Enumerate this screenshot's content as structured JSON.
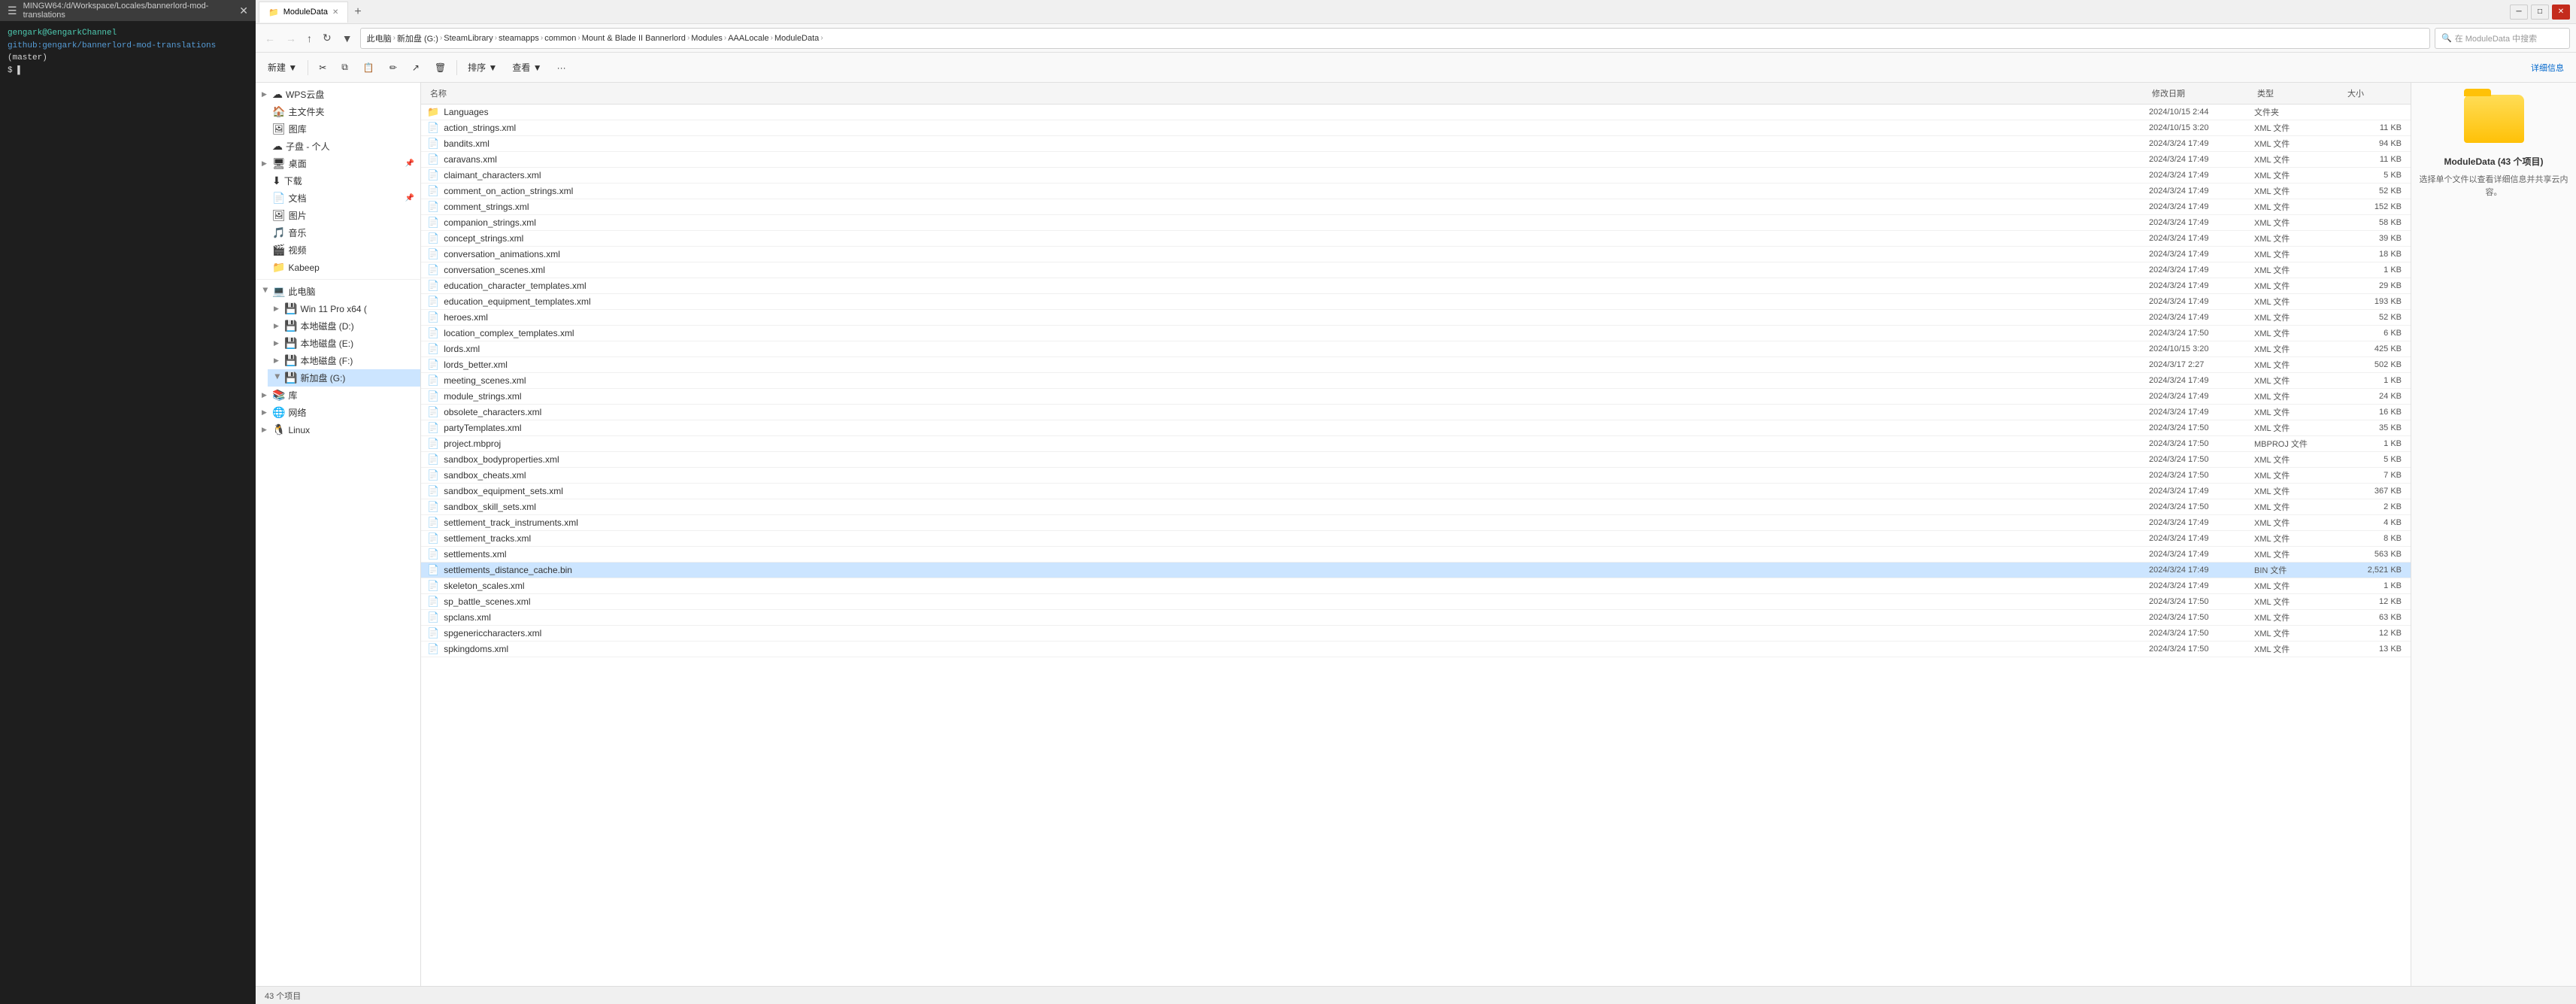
{
  "terminal": {
    "title": "MINGW64:/d/Workspace/Locales/bannerlord-mod-translations",
    "close_btn": "✕",
    "hamburger": "☰",
    "user": "gengark@GengarkChannel",
    "path": "github:gengark/bannerlord-mod-translations",
    "branch": "(master)",
    "prompt": "$",
    "cursor": "▌"
  },
  "explorer": {
    "tab_label": "ModuleData",
    "tab_close": "✕",
    "tab_new": "+",
    "search_placeholder": "在 ModuleData 中搜索",
    "search_icon": "🔍",
    "detail_btn": "详细信息",
    "nav_back": "←",
    "nav_forward": "→",
    "nav_up": "↑",
    "nav_refresh": "↻",
    "nav_path_dropdown": "▼",
    "breadcrumb": [
      "此电脑",
      "新加盘 (G:)",
      "SteamLibrary",
      "steamapps",
      "common",
      "Mount & Blade II Bannerlord",
      "Modules",
      "AAALocale",
      "ModuleData"
    ],
    "toolbar": {
      "new_btn": "新建 ▼",
      "cut_icon": "✂",
      "copy_icon": "⧉",
      "paste_icon": "📋",
      "rename_icon": "✏",
      "share_icon": "↗",
      "delete_icon": "🗑",
      "sort_btn": "排序 ▼",
      "view_btn": "查看 ▼",
      "more_btn": "···"
    },
    "columns": {
      "name": "名称",
      "modified": "修改日期",
      "type": "类型",
      "size": "大小"
    },
    "files": [
      {
        "name": "Languages",
        "modified": "2024/10/15 2:44",
        "type": "文件夹",
        "size": "",
        "icon": "📁",
        "is_folder": true
      },
      {
        "name": "action_strings.xml",
        "modified": "2024/10/15 3:20",
        "type": "XML 文件",
        "size": "11 KB",
        "icon": "📄"
      },
      {
        "name": "bandits.xml",
        "modified": "2024/3/24 17:49",
        "type": "XML 文件",
        "size": "94 KB",
        "icon": "📄"
      },
      {
        "name": "caravans.xml",
        "modified": "2024/3/24 17:49",
        "type": "XML 文件",
        "size": "11 KB",
        "icon": "📄"
      },
      {
        "name": "claimant_characters.xml",
        "modified": "2024/3/24 17:49",
        "type": "XML 文件",
        "size": "5 KB",
        "icon": "📄"
      },
      {
        "name": "comment_on_action_strings.xml",
        "modified": "2024/3/24 17:49",
        "type": "XML 文件",
        "size": "52 KB",
        "icon": "📄"
      },
      {
        "name": "comment_strings.xml",
        "modified": "2024/3/24 17:49",
        "type": "XML 文件",
        "size": "152 KB",
        "icon": "📄"
      },
      {
        "name": "companion_strings.xml",
        "modified": "2024/3/24 17:49",
        "type": "XML 文件",
        "size": "58 KB",
        "icon": "📄"
      },
      {
        "name": "concept_strings.xml",
        "modified": "2024/3/24 17:49",
        "type": "XML 文件",
        "size": "39 KB",
        "icon": "📄"
      },
      {
        "name": "conversation_animations.xml",
        "modified": "2024/3/24 17:49",
        "type": "XML 文件",
        "size": "18 KB",
        "icon": "📄"
      },
      {
        "name": "conversation_scenes.xml",
        "modified": "2024/3/24 17:49",
        "type": "XML 文件",
        "size": "1 KB",
        "icon": "📄"
      },
      {
        "name": "education_character_templates.xml",
        "modified": "2024/3/24 17:49",
        "type": "XML 文件",
        "size": "29 KB",
        "icon": "📄"
      },
      {
        "name": "education_equipment_templates.xml",
        "modified": "2024/3/24 17:49",
        "type": "XML 文件",
        "size": "193 KB",
        "icon": "📄"
      },
      {
        "name": "heroes.xml",
        "modified": "2024/3/24 17:49",
        "type": "XML 文件",
        "size": "52 KB",
        "icon": "📄"
      },
      {
        "name": "location_complex_templates.xml",
        "modified": "2024/3/24 17:50",
        "type": "XML 文件",
        "size": "6 KB",
        "icon": "📄"
      },
      {
        "name": "lords.xml",
        "modified": "2024/10/15 3:20",
        "type": "XML 文件",
        "size": "425 KB",
        "icon": "📄"
      },
      {
        "name": "lords_better.xml",
        "modified": "2024/3/17 2:27",
        "type": "XML 文件",
        "size": "502 KB",
        "icon": "📄"
      },
      {
        "name": "meeting_scenes.xml",
        "modified": "2024/3/24 17:49",
        "type": "XML 文件",
        "size": "1 KB",
        "icon": "📄"
      },
      {
        "name": "module_strings.xml",
        "modified": "2024/3/24 17:49",
        "type": "XML 文件",
        "size": "24 KB",
        "icon": "📄"
      },
      {
        "name": "obsolete_characters.xml",
        "modified": "2024/3/24 17:49",
        "type": "XML 文件",
        "size": "16 KB",
        "icon": "📄"
      },
      {
        "name": "partyTemplates.xml",
        "modified": "2024/3/24 17:50",
        "type": "XML 文件",
        "size": "35 KB",
        "icon": "📄"
      },
      {
        "name": "project.mbproj",
        "modified": "2024/3/24 17:50",
        "type": "MBPROJ 文件",
        "size": "1 KB",
        "icon": "📄"
      },
      {
        "name": "sandbox_bodyproperties.xml",
        "modified": "2024/3/24 17:50",
        "type": "XML 文件",
        "size": "5 KB",
        "icon": "📄"
      },
      {
        "name": "sandbox_cheats.xml",
        "modified": "2024/3/24 17:50",
        "type": "XML 文件",
        "size": "7 KB",
        "icon": "📄"
      },
      {
        "name": "sandbox_equipment_sets.xml",
        "modified": "2024/3/24 17:49",
        "type": "XML 文件",
        "size": "367 KB",
        "icon": "📄"
      },
      {
        "name": "sandbox_skill_sets.xml",
        "modified": "2024/3/24 17:50",
        "type": "XML 文件",
        "size": "2 KB",
        "icon": "📄"
      },
      {
        "name": "settlement_track_instruments.xml",
        "modified": "2024/3/24 17:49",
        "type": "XML 文件",
        "size": "4 KB",
        "icon": "📄"
      },
      {
        "name": "settlement_tracks.xml",
        "modified": "2024/3/24 17:49",
        "type": "XML 文件",
        "size": "8 KB",
        "icon": "📄"
      },
      {
        "name": "settlements.xml",
        "modified": "2024/3/24 17:49",
        "type": "XML 文件",
        "size": "563 KB",
        "icon": "📄"
      },
      {
        "name": "settlements_distance_cache.bin",
        "modified": "2024/3/24 17:49",
        "type": "BIN 文件",
        "size": "2,521 KB",
        "icon": "📄"
      },
      {
        "name": "skeleton_scales.xml",
        "modified": "2024/3/24 17:49",
        "type": "XML 文件",
        "size": "1 KB",
        "icon": "📄"
      },
      {
        "name": "sp_battle_scenes.xml",
        "modified": "2024/3/24 17:50",
        "type": "XML 文件",
        "size": "12 KB",
        "icon": "📄"
      },
      {
        "name": "spclans.xml",
        "modified": "2024/3/24 17:50",
        "type": "XML 文件",
        "size": "63 KB",
        "icon": "📄"
      },
      {
        "name": "spgenericcharacters.xml",
        "modified": "2024/3/24 17:50",
        "type": "XML 文件",
        "size": "12 KB",
        "icon": "📄"
      },
      {
        "name": "spkingdoms.xml",
        "modified": "2024/3/24 17:50",
        "type": "XML 文件",
        "size": "13 KB",
        "icon": "📄"
      }
    ],
    "status_bar": "43 个项目",
    "preview": {
      "title": "ModuleData (43 个项目)",
      "hint": "选择单个文件以查看详细信息并共享云内容。",
      "detail_btn": "详细信息"
    }
  },
  "sidebar": {
    "items": [
      {
        "label": "WPS云盘",
        "icon": "☁",
        "indent": 0,
        "has_arrow": true
      },
      {
        "label": "主文件夹",
        "icon": "🏠",
        "indent": 0,
        "has_arrow": false
      },
      {
        "label": "图库",
        "icon": "🖼",
        "indent": 0,
        "has_arrow": false
      },
      {
        "label": "子盘 - 个人",
        "icon": "☁",
        "indent": 0,
        "has_arrow": false
      },
      {
        "label": "桌面",
        "icon": "🖥",
        "indent": 0,
        "has_arrow": true
      },
      {
        "label": "下载",
        "icon": "⬇",
        "indent": 0,
        "has_arrow": false
      },
      {
        "label": "文档",
        "icon": "📄",
        "indent": 0,
        "has_arrow": false
      },
      {
        "label": "图片",
        "icon": "🖼",
        "indent": 0,
        "has_arrow": false
      },
      {
        "label": "音乐",
        "icon": "🎵",
        "indent": 0,
        "has_arrow": false
      },
      {
        "label": "视频",
        "icon": "🎬",
        "indent": 0,
        "has_arrow": false
      },
      {
        "label": "Kabeep",
        "icon": "📁",
        "indent": 0,
        "has_arrow": false
      },
      {
        "label": "此电脑",
        "icon": "💻",
        "indent": 0,
        "has_arrow": true,
        "expanded": true
      },
      {
        "label": "Win 11 Pro x64 (",
        "icon": "💾",
        "indent": 1,
        "has_arrow": true
      },
      {
        "label": "本地磁盘 (D:)",
        "icon": "💾",
        "indent": 1,
        "has_arrow": true
      },
      {
        "label": "本地磁盘 (E:)",
        "icon": "💾",
        "indent": 1,
        "has_arrow": true
      },
      {
        "label": "本地磁盘 (F:)",
        "icon": "💾",
        "indent": 1,
        "has_arrow": true
      },
      {
        "label": "新加盘 (G:)",
        "icon": "💾",
        "indent": 1,
        "has_arrow": true,
        "selected": true
      },
      {
        "label": "库",
        "icon": "📚",
        "indent": 0,
        "has_arrow": true
      },
      {
        "label": "网络",
        "icon": "🌐",
        "indent": 0,
        "has_arrow": true
      },
      {
        "label": "Linux",
        "icon": "🐧",
        "indent": 0,
        "has_arrow": true
      }
    ]
  }
}
